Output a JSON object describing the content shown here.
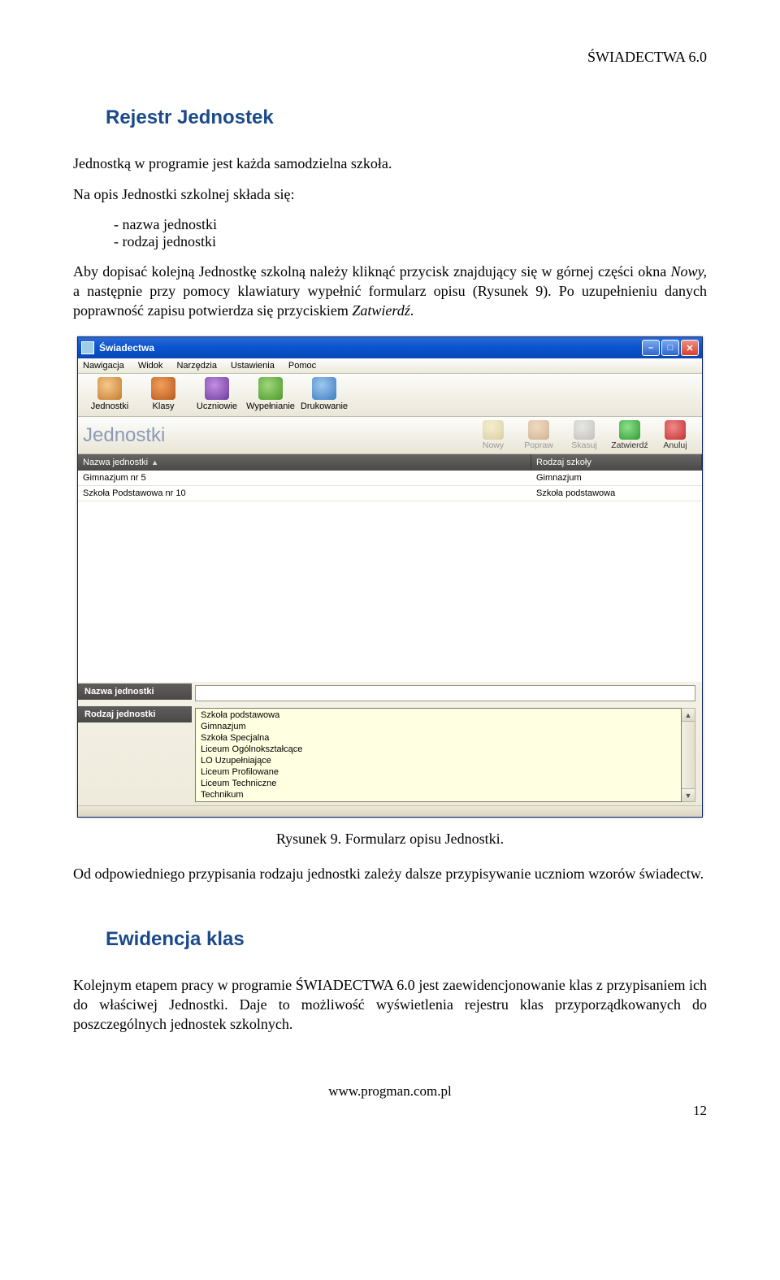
{
  "doc": {
    "header_right": "ŚWIADECTWA 6.0",
    "h2_rejestr": "Rejestr Jednostek",
    "p_intro": "Jednostką w programie jest każda samodzielna szkoła.",
    "p_opis_lead": "Na opis Jednostki szkolnej składa się:",
    "bullets": [
      "nazwa jednostki",
      "rodzaj jednostki"
    ],
    "p_aby_pre": "Aby dopisać kolejną Jednostkę szkolną należy kliknąć przycisk znajdujący się w górnej części okna ",
    "p_aby_italic1": "Nowy,",
    "p_aby_mid": " a następnie przy pomocy klawiatury wypełnić formularz opisu (Rysunek 9). Po uzupełnieniu danych poprawność zapisu potwierdza się przyciskiem ",
    "p_aby_italic2": "Zatwierdź",
    "p_aby_post": ".",
    "caption": "Rysunek 9. Formularz opisu Jednostki.",
    "p_od": "Od odpowiedniego przypisania rodzaju jednostki zależy dalsze przypisywanie uczniom wzorów świadectw.",
    "h2_ewid": "Ewidencja klas",
    "p_kolejnym": "Kolejnym etapem pracy w programie ŚWIADECTWA 6.0 jest zaewidencjonowanie klas z przypisaniem ich do właściwej Jednostki. Daje to możliwość wyświetlenia rejestru klas przyporządkowanych do poszczególnych jednostek szkolnych.",
    "footer_url": "www.progman.com.pl",
    "page_num": "12"
  },
  "app": {
    "window_title": "Świadectwa",
    "menu": [
      "Nawigacja",
      "Widok",
      "Narzędzia",
      "Ustawienia",
      "Pomoc"
    ],
    "nav": [
      {
        "label": "Jednostki"
      },
      {
        "label": "Klasy"
      },
      {
        "label": "Uczniowie"
      },
      {
        "label": "Wypełnianie"
      },
      {
        "label": "Drukowanie"
      }
    ],
    "section_title": "Jednostki",
    "actions": [
      {
        "label": "Nowy",
        "icon": "nowy",
        "disabled": true
      },
      {
        "label": "Popraw",
        "icon": "popraw",
        "disabled": true
      },
      {
        "label": "Skasuj",
        "icon": "skasuj",
        "disabled": true
      },
      {
        "label": "Zatwierdź",
        "icon": "zatw",
        "disabled": false
      },
      {
        "label": "Anuluj",
        "icon": "anuluj",
        "disabled": false
      }
    ],
    "grid": {
      "col_nazwa": "Nazwa jednostki",
      "col_rodzaj": "Rodzaj szkoły",
      "rows": [
        {
          "nazwa": "Gimnazjum nr 5",
          "rodzaj": "Gimnazjum"
        },
        {
          "nazwa": "Szkoła Podstawowa nr 10",
          "rodzaj": "Szkoła podstawowa"
        }
      ]
    },
    "form": {
      "label_nazwa": "Nazwa jednostki",
      "label_rodzaj": "Rodzaj jednostki",
      "options": [
        "Szkoła podstawowa",
        "Gimnazjum",
        "Szkoła Specjalna",
        "Liceum Ogólnokształcące",
        "LO Uzupełniające",
        "Liceum Profilowane",
        "Liceum Techniczne",
        "Technikum"
      ]
    }
  }
}
